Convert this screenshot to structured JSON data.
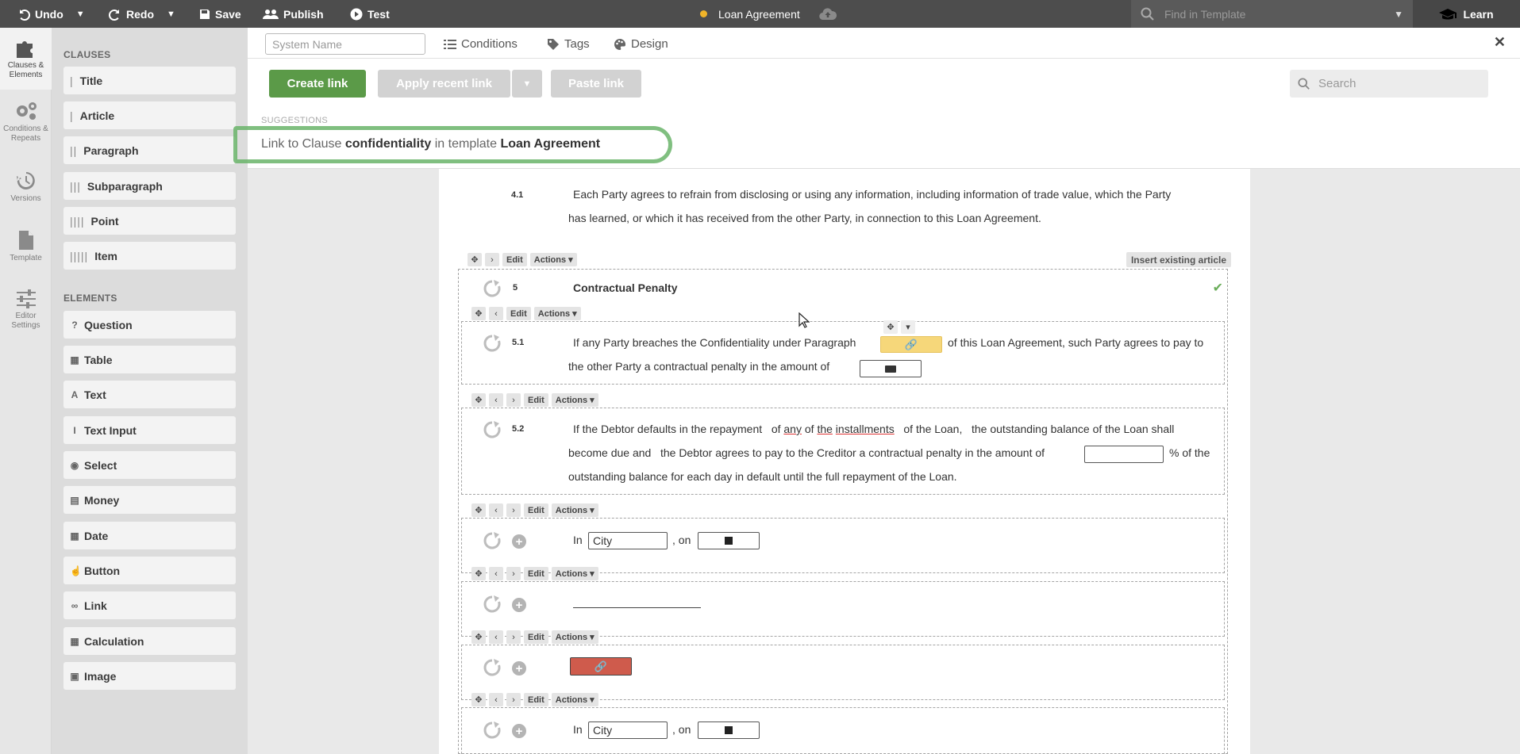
{
  "topbar": {
    "undo": "Undo",
    "redo": "Redo",
    "save": "Save",
    "publish": "Publish",
    "test": "Test",
    "doc_title": "Loan Agreement",
    "find_placeholder": "Find in Template",
    "learn": "Learn"
  },
  "rail": [
    {
      "label": "Clauses & Elements",
      "icon": "puzzle-icon"
    },
    {
      "label": "Conditions & Repeats",
      "icon": "gears-icon"
    },
    {
      "label": "Versions",
      "icon": "history-icon"
    },
    {
      "label": "Template",
      "icon": "file-icon"
    },
    {
      "label": "Editor Settings",
      "icon": "sliders-icon"
    }
  ],
  "panel": {
    "clauses_heading": "CLAUSES",
    "clauses": [
      "Title",
      "Article",
      "Paragraph",
      "Subparagraph",
      "Point",
      "Item"
    ],
    "elements_heading": "ELEMENTS",
    "elements": [
      "Question",
      "Table",
      "Text",
      "Text Input",
      "Select",
      "Money",
      "Date",
      "Button",
      "Link",
      "Calculation",
      "Image"
    ]
  },
  "main": {
    "system_name_placeholder": "System Name",
    "tabs": [
      "Conditions",
      "Tags",
      "Design"
    ],
    "close": "✕",
    "create_link": "Create link",
    "apply_recent_link": "Apply recent link",
    "paste_link": "Paste link",
    "search_placeholder": "Search",
    "suggestions_heading": "SUGGESTIONS",
    "suggestion": {
      "prefix": "Link to Clause",
      "clause": "confidentiality",
      "middle": "in template",
      "template": "Loan Agreement"
    }
  },
  "doc": {
    "p41_num": "4.1",
    "p41_line1": "Each Party agrees to refrain from disclosing or using any information, including information of trade value, which the Party",
    "p41_line2": "has learned, or which it has received from the other Party, in connection to this Loan Agreement.",
    "tools": {
      "edit": "Edit",
      "actions": "Actions"
    },
    "insert_existing_article": "Insert existing article",
    "a5_num": "5",
    "a5_title": "Contractual Penalty",
    "p51_num": "5.1",
    "p51_a": "If any Party breaches the Confidentiality under Paragraph",
    "p51_b": "of this Loan Agreement, such Party agrees to pay to",
    "p51_c": "the other Party a contractual penalty in the amount of",
    "p52_num": "5.2",
    "p52_a": "If the Debtor defaults in the repayment",
    "p52_of": "of",
    "p52_any": "any",
    "p52_of2": "of",
    "p52_the": "the",
    "p52_inst": "installments",
    "p52_b": "of the Loan,   the outstanding balance of the Loan shall",
    "p52_c": "become due and   the Debtor agrees to pay to the Creditor a contractual penalty in the amount of",
    "p52_d": "% of the",
    "p52_e": "outstanding balance for each day in default until the full repayment of the Loan.",
    "sig_in": "In",
    "sig_city": "City",
    "sig_on": ", on"
  }
}
